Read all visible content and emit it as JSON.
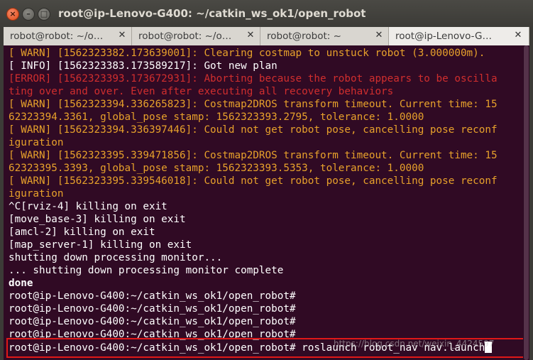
{
  "window": {
    "title": "root@ip-Lenovo-G400: ~/catkin_ws_ok1/open_robot",
    "close_glyph": "×",
    "min_glyph": "–",
    "max_glyph": "□"
  },
  "tabs": [
    {
      "label": "robot@robot: ~/o…",
      "close": "✕",
      "active": false
    },
    {
      "label": "robot@robot: ~/o…",
      "close": "✕",
      "active": false
    },
    {
      "label": "robot@robot: ~",
      "close": "✕",
      "active": false
    },
    {
      "label": "root@ip-Lenovo-G…",
      "close": "✕",
      "active": true
    }
  ],
  "terminal": {
    "lines": [
      "[ WARN] [1562323382.173639001]: Clearing costmap to unstuck robot (3.000000m).",
      "[ INFO] [1562323383.173589217]: Got new plan",
      "[ERROR] [1562323393.173672931]: Aborting because the robot appears to be oscilla",
      "ting over and over. Even after executing all recovery behaviors",
      "[ WARN] [1562323394.336265823]: Costmap2DROS transform timeout. Current time: 15",
      "62323394.3361, global_pose stamp: 1562323393.2795, tolerance: 1.0000",
      "[ WARN] [1562323394.336397446]: Could not get robot pose, cancelling pose reconf",
      "iguration",
      "[ WARN] [1562323395.339471856]: Costmap2DROS transform timeout. Current time: 15",
      "62323395.3393, global_pose stamp: 1562323393.5353, tolerance: 1.0000",
      "[ WARN] [1562323395.339546018]: Could not get robot pose, cancelling pose reconf",
      "iguration",
      "^C[rviz-4] killing on exit",
      "[move_base-3] killing on exit",
      "[amcl-2] killing on exit",
      "[map_server-1] killing on exit",
      "shutting down processing monitor...",
      "... shutting down processing monitor complete",
      "done",
      "root@ip-Lenovo-G400:~/catkin_ws_ok1/open_robot#",
      "root@ip-Lenovo-G400:~/catkin_ws_ok1/open_robot#",
      "root@ip-Lenovo-G400:~/catkin_ws_ok1/open_robot#",
      "root@ip-Lenovo-G400:~/catkin_ws_ok1/open_robot#"
    ],
    "line_kinds": [
      "warn",
      "white",
      "err",
      "err",
      "warn",
      "warn",
      "warn",
      "warn",
      "warn",
      "warn",
      "warn",
      "warn",
      "white",
      "white",
      "white",
      "white",
      "white",
      "white",
      "bold",
      "white",
      "white",
      "white",
      "white"
    ],
    "prompt": "root@ip-Lenovo-G400:~/catkin_ws_ok1/open_robot#",
    "command": " roslaunch robot_nav nav.launch",
    "watermark": "https://blog.csdn.net/weixin_4424597",
    "colors": {
      "warn": "#e7a12b",
      "error": "#d02e2e",
      "text": "#ffffff",
      "background": "#300a24",
      "highlight": "#e01818"
    }
  }
}
